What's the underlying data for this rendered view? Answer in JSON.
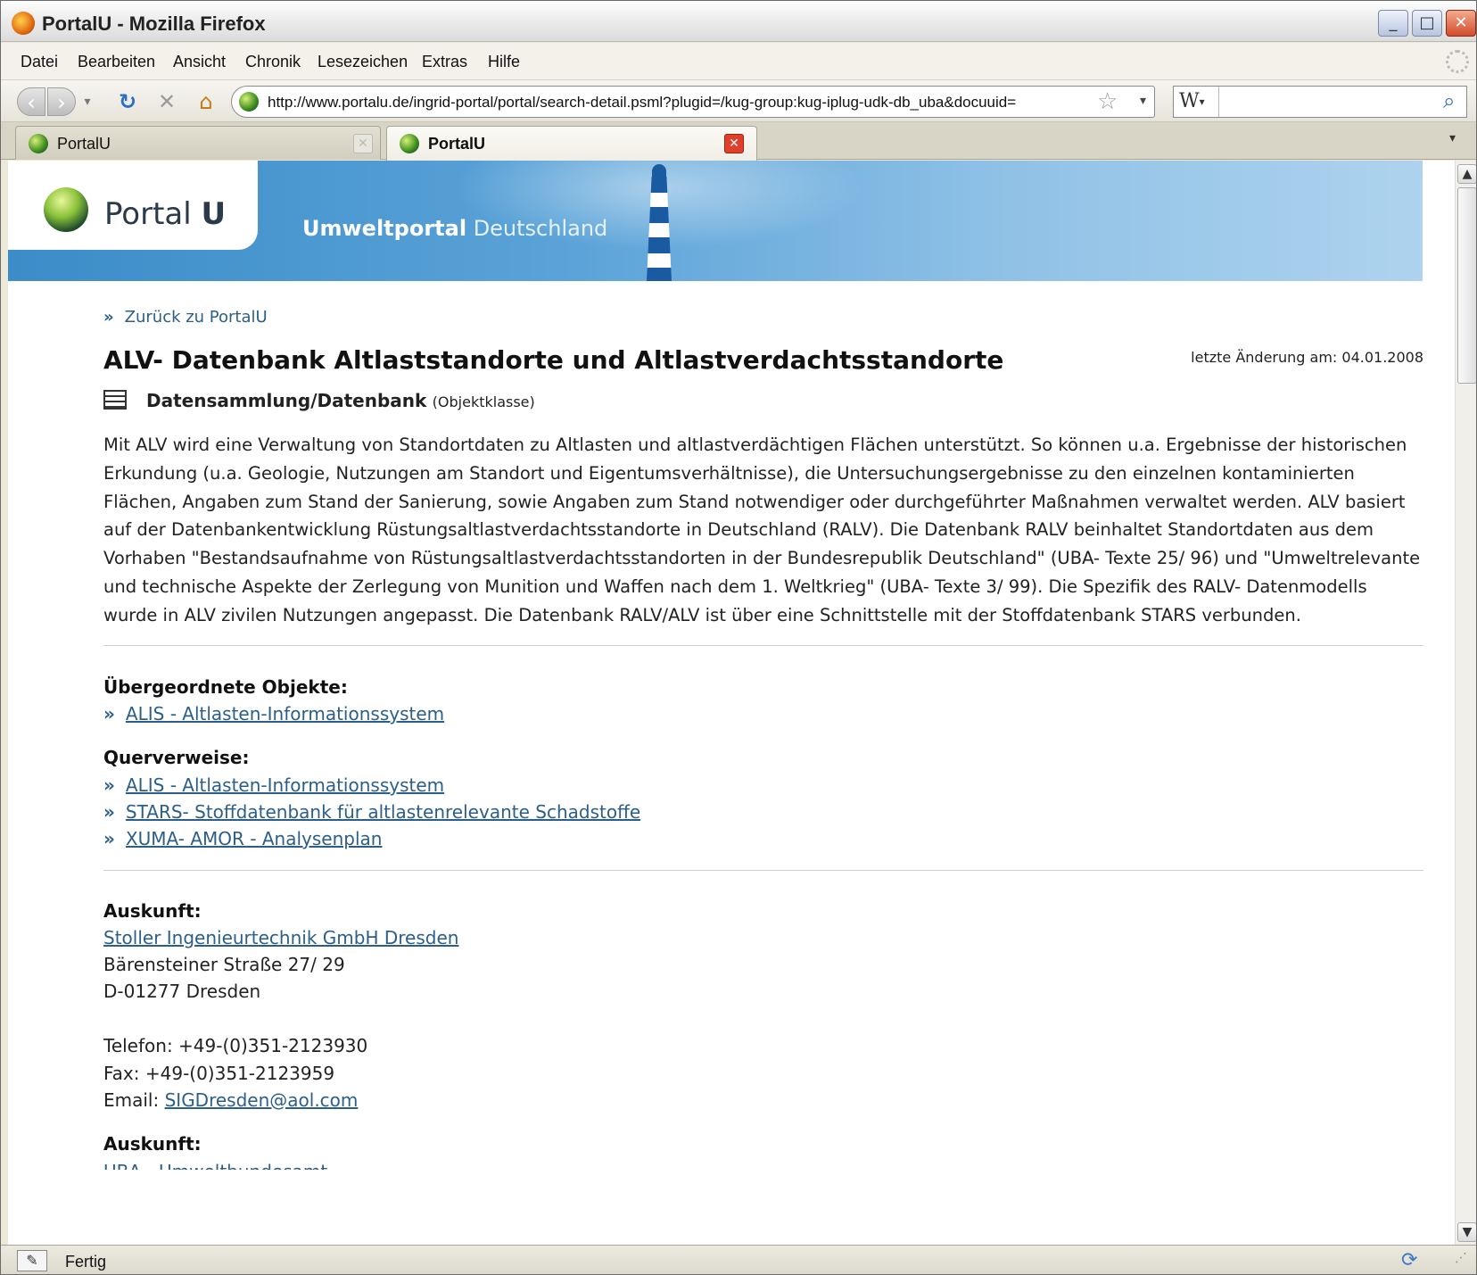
{
  "window": {
    "title": "PortalU - Mozilla Firefox"
  },
  "menu": [
    "Datei",
    "Bearbeiten",
    "Ansicht",
    "Chronik",
    "Lesezeichen",
    "Extras",
    "Hilfe"
  ],
  "navbar": {
    "url": "http://www.portalu.de/ingrid-portal/portal/search-detail.psml?plugid=/kug-group:kug-iplug-udk-db_uba&docuuid=",
    "search_engine": "W",
    "search_value": ""
  },
  "tabs": [
    {
      "label": "PortalU",
      "active": false
    },
    {
      "label": "PortalU",
      "active": true
    }
  ],
  "banner": {
    "logo_light": "Portal",
    "logo_bold": "U",
    "tagline_strong": "Umweltportal",
    "tagline_light": "Deutschland"
  },
  "page": {
    "back_link": "Zurück zu PortalU",
    "title": "ALV- Datenbank Altlaststandorte und Altlastverdachtsstandorte",
    "last_change": "letzte Änderung am: 04.01.2008",
    "object_class": "Datensammlung/Datenbank",
    "object_class_note": "(Objektklasse)",
    "description": "Mit ALV wird eine Verwaltung von Standortdaten zu Altlasten und altlastverdächtigen Flächen unterstützt. So können u.a. Ergebnisse der historischen Erkundung (u.a. Geologie, Nutzungen am Standort und Eigentumsverhältnisse), die Untersuchungsergebnisse zu den einzelnen kontaminierten Flächen, Angaben zum Stand der Sanierung, sowie Angaben zum Stand notwendiger oder durchgeführter Maßnahmen verwaltet werden. ALV basiert auf der Datenbankentwicklung Rüstungsaltlastverdachtsstandorte in Deutschland (RALV). Die Datenbank RALV beinhaltet Standortdaten aus dem Vorhaben \"Bestandsaufnahme von Rüstungsaltlastverdachtsstandorten in der Bundesrepublik Deutschland\" (UBA- Texte 25/ 96) und \"Umweltrelevante und technische Aspekte der Zerlegung von Munition und Waffen nach dem 1. Weltkrieg\" (UBA- Texte 3/ 99). Die Spezifik des RALV- Datenmodells wurde in ALV zivilen Nutzungen angepasst. Die Datenbank RALV/ALV ist über eine Schnittstelle mit der Stoffdatenbank STARS verbunden.",
    "parents_title": "Übergeordnete Objekte:",
    "parents": [
      "ALIS - Altlasten-Informationssystem"
    ],
    "xref_title": "Querverweise:",
    "xrefs": [
      "ALIS - Altlasten-Informationssystem",
      "STARS- Stoffdatenbank für altlastenrelevante Schadstoffe",
      "XUMA- AMOR - Analysenplan"
    ],
    "contact_title": "Auskunft:",
    "contact_org": "Stoller Ingenieurtechnik GmbH Dresden",
    "contact_street": "Bärensteiner Straße 27/ 29",
    "contact_city": "D-01277 Dresden",
    "contact_phone": "Telefon: +49-(0)351-2123930",
    "contact_fax": "Fax: +49-(0)351-2123959",
    "contact_email_label": "Email: ",
    "contact_email": "SIGDresden@aol.com",
    "contact_title_2": "Auskunft:",
    "contact_org_2": "UBA - Umweltbundesamt"
  },
  "status": {
    "text": "Fertig"
  },
  "icons": {
    "raquo": "»",
    "star": "☆",
    "search_go": "⌕",
    "reload": "↻",
    "stop": "✕",
    "home": "⌂"
  }
}
